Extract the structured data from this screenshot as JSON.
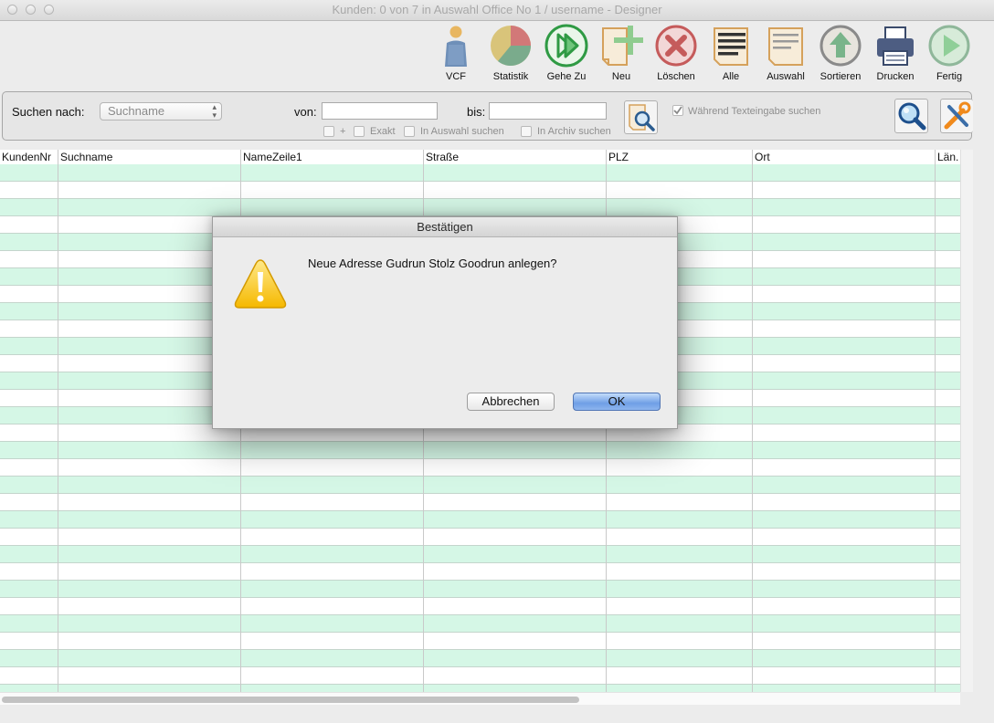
{
  "window": {
    "title": "Kunden: 0 von 7 in Auswahl Office No 1 /  username - Designer"
  },
  "toolbar": {
    "buttons": [
      {
        "label": "VCF",
        "icon": "person-icon"
      },
      {
        "label": "Statistik",
        "icon": "pie-chart-icon"
      },
      {
        "label": "Gehe Zu",
        "icon": "go-to-icon"
      },
      {
        "label": "Neu",
        "icon": "new-document-icon"
      },
      {
        "label": "Löschen",
        "icon": "delete-icon"
      },
      {
        "label": "Alle",
        "icon": "all-documents-icon"
      },
      {
        "label": "Auswahl",
        "icon": "selection-document-icon"
      },
      {
        "label": "Sortieren",
        "icon": "sort-up-icon"
      },
      {
        "label": "Drucken",
        "icon": "printer-icon"
      },
      {
        "label": "Fertig",
        "icon": "play-icon"
      }
    ]
  },
  "search": {
    "label": "Suchen nach:",
    "field_value": "Suchname",
    "von_label": "von:",
    "bis_label": "bis:",
    "von_value": "",
    "bis_value": "",
    "plus_label": "+",
    "exakt_label": "Exakt",
    "auswahl_label": "In Auswahl suchen",
    "archiv_label": "In Archiv suchen",
    "live_label": "Während Texteingabe suchen",
    "live_checked": true
  },
  "table": {
    "columns": [
      "KundenNr",
      "Suchname",
      "NameZeile1",
      "Straße",
      "PLZ",
      "Ort",
      "Län."
    ],
    "row_colors": [
      "#d5f7e6",
      "#ffffff"
    ]
  },
  "dialog": {
    "title": "Bestätigen",
    "message": "Neue Adresse Gudrun Stolz Goodrun anlegen?",
    "icon": "warning-icon",
    "cancel_label": "Abbrechen",
    "ok_label": "OK"
  }
}
